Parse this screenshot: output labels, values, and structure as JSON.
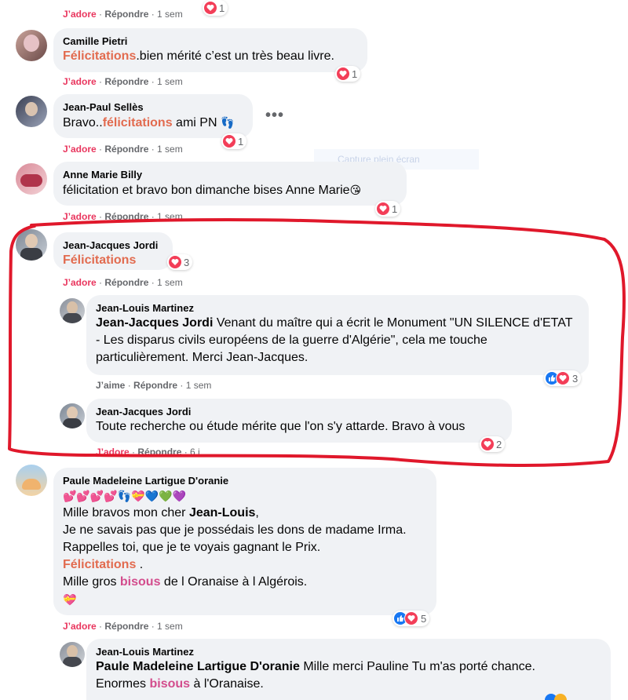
{
  "comments": [
    {
      "id": "c0",
      "actions": {
        "like": "J’adore",
        "reply": "Répondre",
        "time": "1 sem"
      },
      "reactions": "1"
    },
    {
      "id": "c1",
      "author": "Camille Pietri",
      "highlight": "Félicitations",
      "text": ".bien mérité c’est un très beau livre.",
      "actions": {
        "like": "J’adore",
        "reply": "Répondre",
        "time": "1 sem"
      },
      "reactions": "1"
    },
    {
      "id": "c2",
      "author": "Jean-Paul Sellès",
      "pre": "Bravo..",
      "highlight": "félicitations",
      "text": " ami PN",
      "actions": {
        "like": "J’adore",
        "reply": "Répondre",
        "time": "1 sem"
      },
      "reactions": "1",
      "more": "•••"
    },
    {
      "id": "c3",
      "author": "Anne Marie Billy",
      "text": "félicitation et bravo bon dimanche bises Anne Marie",
      "actions": {
        "like": "J’adore",
        "reply": "Répondre",
        "time": "1 sem"
      },
      "reactions": "1"
    },
    {
      "id": "c4",
      "author": "Jean-Jacques Jordi",
      "highlight": "Félicitations",
      "actions": {
        "like": "J’adore",
        "reply": "Répondre",
        "time": "1 sem"
      },
      "reactions": "3"
    },
    {
      "id": "r1",
      "author": "Jean-Louis Martinez",
      "mention": "Jean-Jacques Jordi",
      "text": " Venant du maître qui a écrit le Monument \"UN SILENCE d'ETAT - Les disparus civils européens de la guerre d'Algérie\", cela me touche particulièrement. Merci Jean-Jacques.",
      "actions": {
        "like": "J’aime",
        "reply": "Répondre",
        "time": "1 sem"
      },
      "reactions": "3"
    },
    {
      "id": "r2",
      "author": "Jean-Jacques Jordi",
      "text": "Toute recherche ou étude mérite que l'on s'y attarde. Bravo à vous",
      "actions": {
        "like": "J’adore",
        "reply": "Répondre",
        "time": "6 j"
      },
      "reactions": "2"
    },
    {
      "id": "c5",
      "author": "Paule Madeleine Lartigue D'oranie",
      "line1_pre": "Mille bravos mon cher ",
      "line1_mention": "Jean-Louis",
      "line1_post": ",",
      "line2": "Je ne savais pas que je possédais les dons de madame Irma.",
      "line3": "Rappelles toi, que je te voyais gagnant le Prix.",
      "line4_hl": "Félicitations",
      "line4_post": " .",
      "line5_pre": "Mille gros ",
      "line5_hl": "bisous",
      "line5_post": " de l Oranaise à l Algérois.",
      "actions": {
        "like": "J’adore",
        "reply": "Répondre",
        "time": "1 sem"
      },
      "reactions": "5"
    },
    {
      "id": "r3",
      "author": "Jean-Louis Martinez",
      "mention": "Paule Madeleine Lartigue D'oranie",
      "text": " Mille merci Pauline Tu m'as porté chance.",
      "line2_pre": "Enormes ",
      "line2_hl": "bisous",
      "line2_post": " à l'Oranaise."
    }
  ],
  "ghost_tooltip": "Capture plein écran",
  "colors": {
    "annotation": "#e0182b",
    "highlight": "#e26b4f",
    "heart": "#f33e58",
    "like": "#1877f2"
  }
}
